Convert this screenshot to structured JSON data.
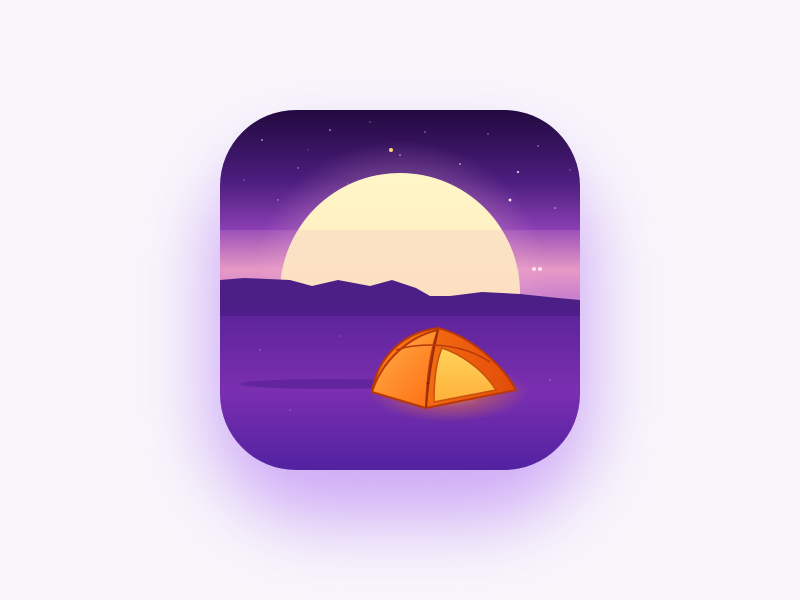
{
  "app_icon": {
    "icon": "camping-tent-night-icon",
    "scene": {
      "sky_top_color": "#2b0f4a",
      "sky_mid_color": "#6a2f9e",
      "horizon_glow_color": "#f6a8c4",
      "moon_color": "#fff6cf",
      "mountain_color": "#4a1f86",
      "ground_color": "#6b2aa8",
      "tent_color": "#ff7a14",
      "tent_glow_color": "#ffd24a"
    },
    "background_color": "#f8f5fb",
    "shadow_color": "#9646f0"
  }
}
